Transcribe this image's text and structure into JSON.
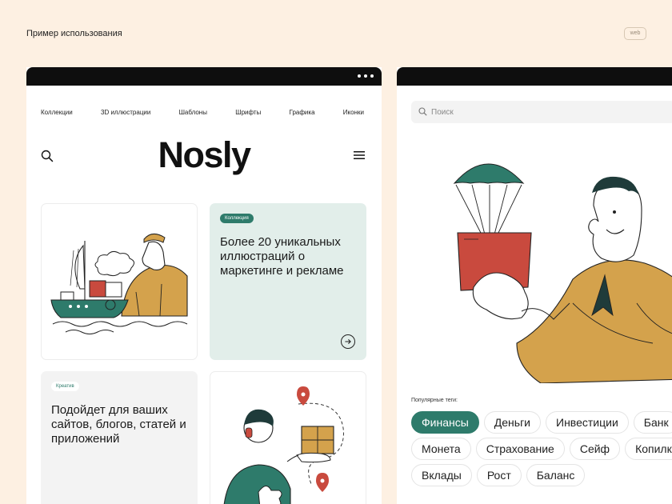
{
  "caption": "Пример использования",
  "chip": "web",
  "left_window": {
    "nav": [
      "Коллекции",
      "3D иллюстрации",
      "Шаблоны",
      "Шрифты",
      "Графика",
      "Иконки"
    ],
    "logo": "Nosly",
    "card_collection": {
      "badge": "Коллекция",
      "title": "Более 20 уникальных иллюстраций о маркетинге и рекламе"
    },
    "card_creative": {
      "badge": "Креатив",
      "title": "Подойдет для ваших сайтов, блогов, статей и приложений"
    }
  },
  "right_window": {
    "search_placeholder": "Поиск",
    "tags_label": "Популярные теги:",
    "tag_rows": [
      [
        "Финансы",
        "Деньги",
        "Инвестиции",
        "Банк"
      ],
      [
        "Монета",
        "Страхование",
        "Сейф",
        "Копилка"
      ],
      [
        "Вклады",
        "Рост",
        "Баланс"
      ]
    ],
    "active_tag": "Финансы"
  },
  "colors": {
    "background": "#FDF0E2",
    "accent": "#2E7B6B",
    "ochre": "#D4A24C",
    "red": "#C94A3E",
    "card_mint": "#E2EEEA",
    "titlebar": "#0E0E0E"
  },
  "icons": [
    "search-icon",
    "menu-icon",
    "arrow-right-icon",
    "more-dots-icon"
  ]
}
